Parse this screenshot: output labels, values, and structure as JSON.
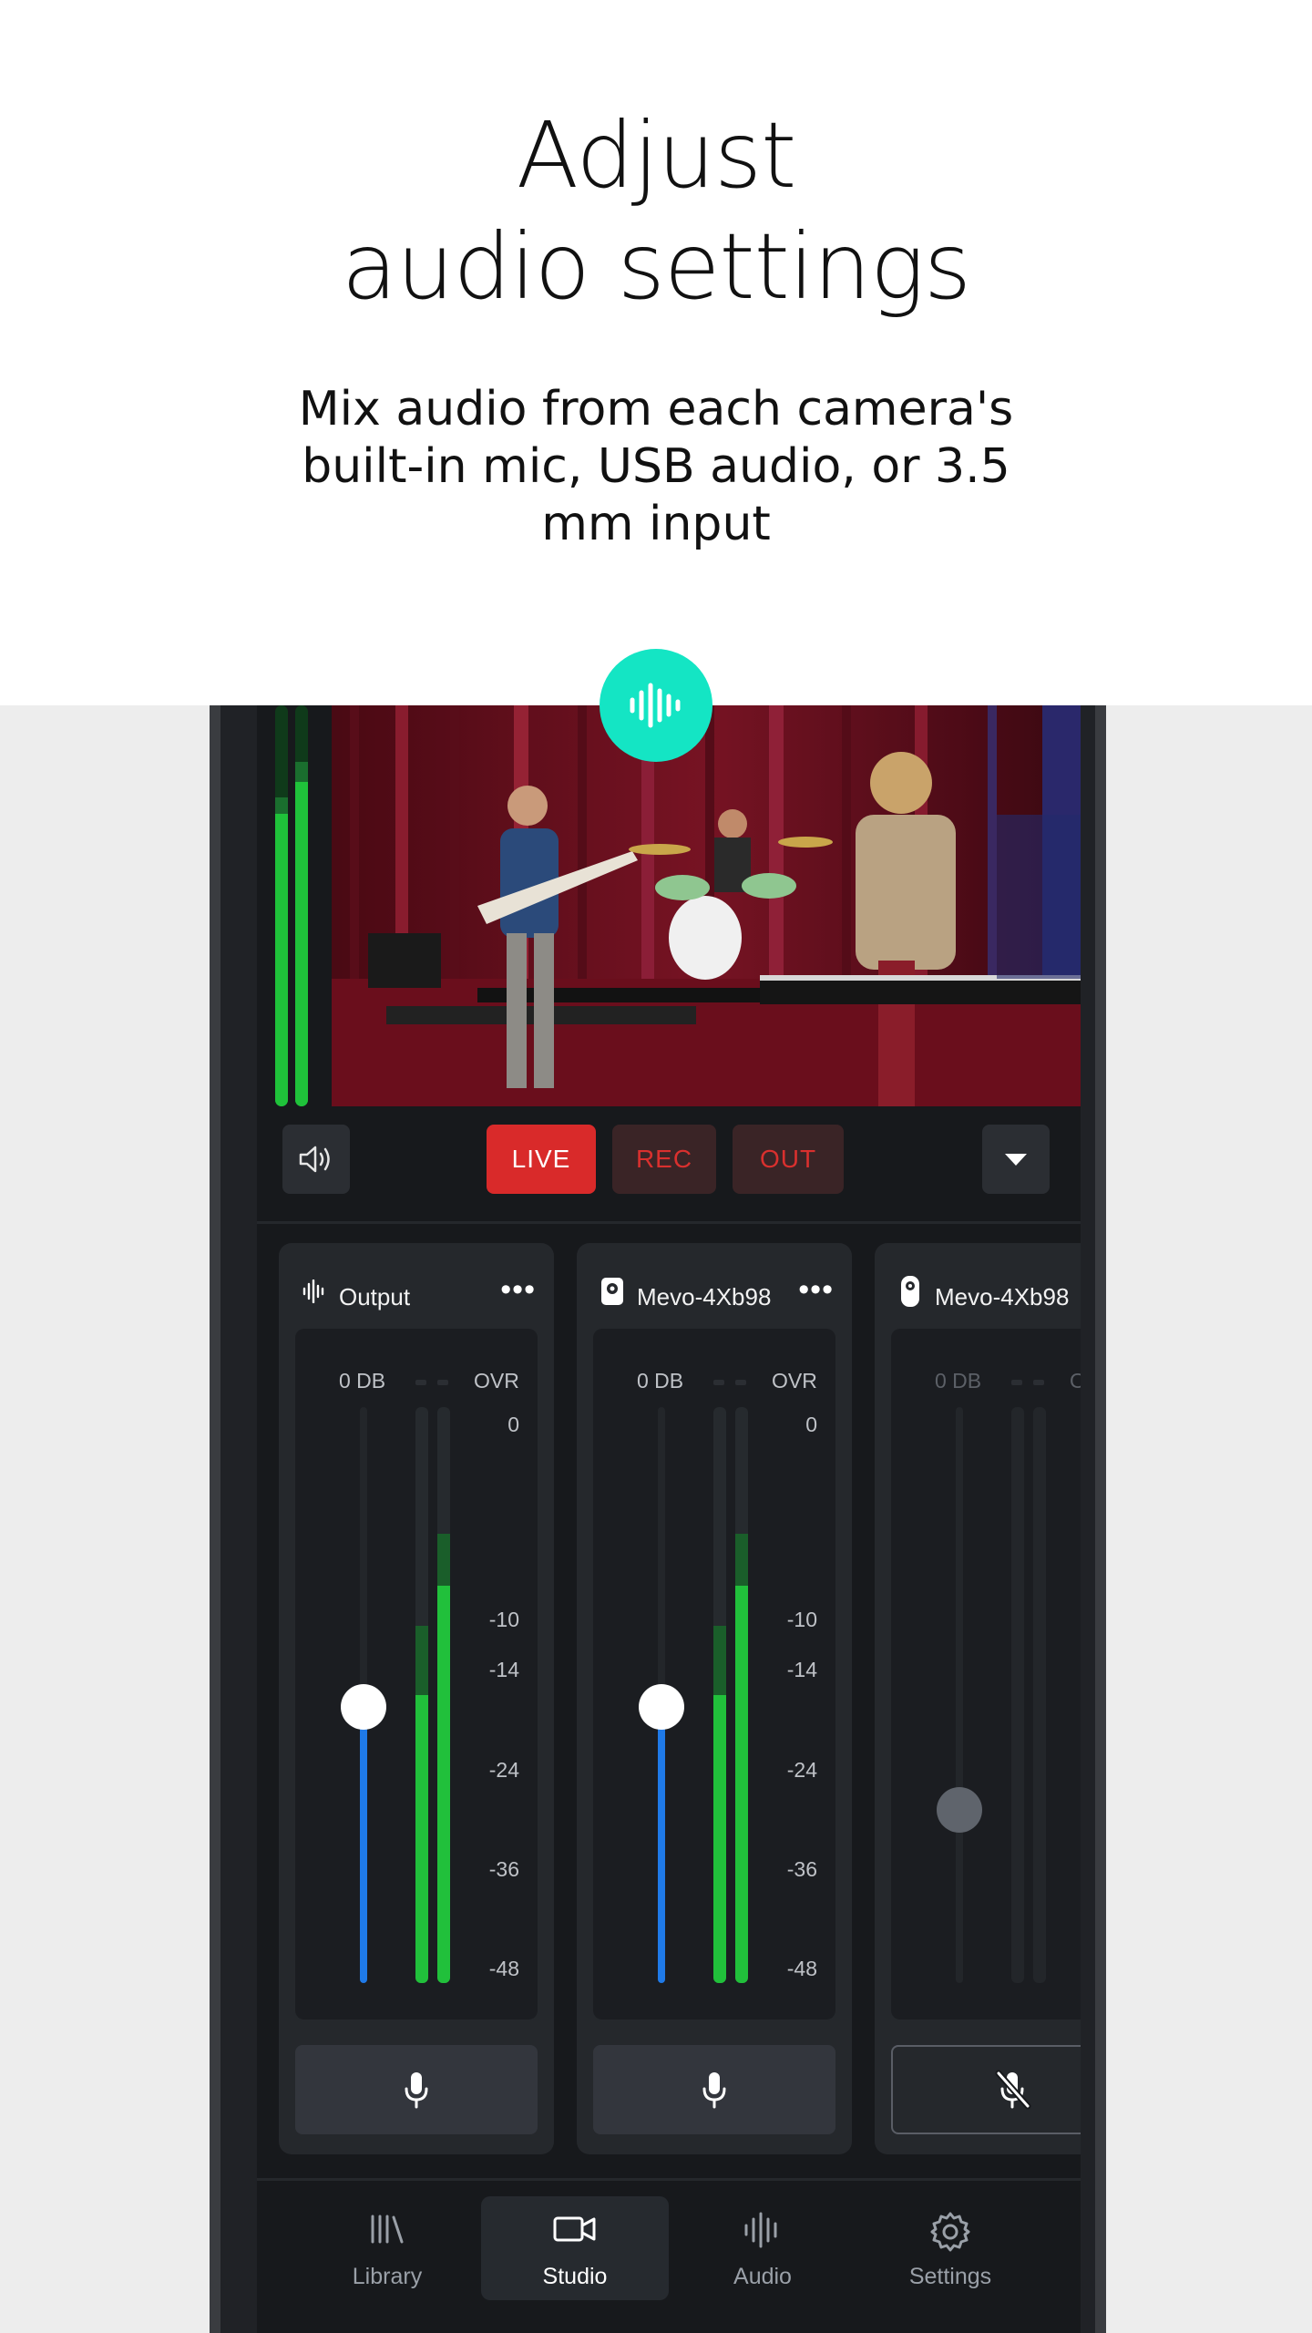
{
  "hero": {
    "title_line1": "Adjust",
    "title_line2": "audio settings",
    "subtitle": "Mix audio from each camera's built-in mic, USB audio, or 3.5 mm input"
  },
  "badge": {
    "icon": "audio-waveform-icon",
    "color": "#14e5c4"
  },
  "controls": {
    "live": "LIVE",
    "rec": "REC",
    "out": "OUT",
    "speaker_icon": "speaker-icon",
    "dropdown_icon": "caret-down-icon"
  },
  "video_meters": {
    "left_level": 0.73,
    "right_level": 0.81
  },
  "channels": [
    {
      "name": "Output",
      "icon": "audio-waveform-icon",
      "more": "•••",
      "db_label": "0 DB",
      "ovr_label": "OVR",
      "scale": [
        "0",
        "-10",
        "-14",
        "-24",
        "-36",
        "-48"
      ],
      "fader_level": 0.48,
      "meter_left": 0.5,
      "meter_right": 0.69,
      "muted": false
    },
    {
      "name": "Mevo-4Xb98",
      "icon": "camera-icon",
      "more": "•••",
      "db_label": "0 DB",
      "ovr_label": "OVR",
      "scale": [
        "0",
        "-10",
        "-14",
        "-24",
        "-36",
        "-48"
      ],
      "fader_level": 0.48,
      "meter_left": 0.5,
      "meter_right": 0.69,
      "muted": false
    },
    {
      "name": "Mevo-4Xb98",
      "icon": "camera-icon",
      "db_label": "0 DB",
      "ovr_label": "OVR",
      "fader_level": 0.3,
      "muted": true
    }
  ],
  "nav": [
    {
      "label": "Library",
      "icon": "library-icon"
    },
    {
      "label": "Studio",
      "icon": "video-camera-icon",
      "active": true
    },
    {
      "label": "Audio",
      "icon": "audio-waveform-icon"
    },
    {
      "label": "Settings",
      "icon": "gear-icon"
    }
  ]
}
